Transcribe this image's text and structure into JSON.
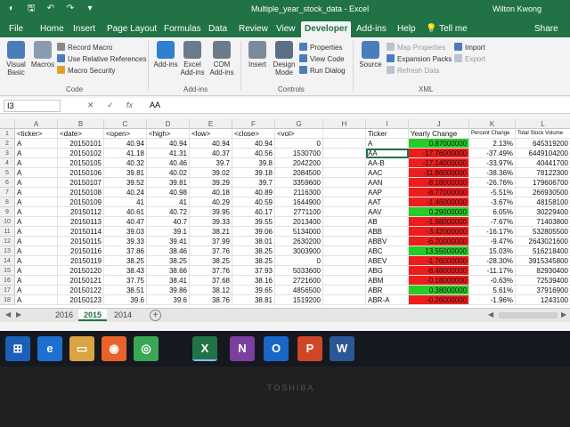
{
  "window": {
    "title": "Multiple_year_stock_data - Excel",
    "user": "Wilton Kwong"
  },
  "ribbon_tabs": [
    "File",
    "Home",
    "Insert",
    "Page Layout",
    "Formulas",
    "Data",
    "Review",
    "View",
    "Developer",
    "Add-ins",
    "Help"
  ],
  "active_tab": "Developer",
  "tell_me": "Tell me",
  "share": "Share",
  "ribbon": {
    "code": {
      "visual_basic": "Visual Basic",
      "macros": "Macros",
      "record_macro": "Record Macro",
      "relative_refs": "Use Relative References",
      "macro_security": "Macro Security",
      "label": "Code"
    },
    "addins": {
      "addins": "Add-ins",
      "excel_addins": "Excel Add-ins",
      "com_addins": "COM Add-ins",
      "label": "Add-ins"
    },
    "controls": {
      "insert": "Insert",
      "design_mode": "Design Mode",
      "properties": "Properties",
      "view_code": "View Code",
      "run_dialog": "Run Dialog",
      "label": "Controls"
    },
    "xml": {
      "source": "Source",
      "map_properties": "Map Properties",
      "expansion_packs": "Expansion Packs",
      "refresh_data": "Refresh Data",
      "import": "Import",
      "export": "Export",
      "label": "XML"
    }
  },
  "formula_bar": {
    "name_box": "I3",
    "value": "AA"
  },
  "columns": [
    "A",
    "B",
    "C",
    "D",
    "E",
    "F",
    "G",
    "H",
    "I",
    "J",
    "K",
    "L"
  ],
  "rows": [
    [
      "<ticker>",
      "<date>",
      "<open>",
      "<high>",
      "<low>",
      "<close>",
      "<vol>",
      "",
      "Ticker",
      "Yearly Change",
      "Percent Change",
      "Total Stock Volume"
    ],
    [
      "A",
      "20150101",
      "40.94",
      "40.94",
      "40.94",
      "40.94",
      "0",
      "",
      "A",
      "0.87000000",
      "2.13%",
      "645319200"
    ],
    [
      "A",
      "20150102",
      "41.18",
      "41.31",
      "40.37",
      "40.56",
      "1530700",
      "",
      "AA",
      "-17.76000000",
      "-37.49%",
      "6449104200"
    ],
    [
      "A",
      "20150105",
      "40.32",
      "40.46",
      "39.7",
      "39.8",
      "2042200",
      "",
      "AA-B",
      "-17.14000000",
      "-33.97%",
      "40441700"
    ],
    [
      "A",
      "20150106",
      "39.81",
      "40.02",
      "39.02",
      "39.18",
      "2084500",
      "",
      "AAC",
      "-11.86000000",
      "-38.36%",
      "78122300"
    ],
    [
      "A",
      "20150107",
      "39.52",
      "39.81",
      "39.29",
      "39.7",
      "3359600",
      "",
      "AAN",
      "-8.18000000",
      "-26.76%",
      "179606700"
    ],
    [
      "A",
      "20150108",
      "40.24",
      "40.98",
      "40.18",
      "40.89",
      "2116300",
      "",
      "AAP",
      "-8.77000000",
      "-5.51%",
      "266930500"
    ],
    [
      "A",
      "20150109",
      "41",
      "41",
      "40.29",
      "40.59",
      "1644900",
      "",
      "AAT",
      "-1.46000000",
      "-3.67%",
      "48158100"
    ],
    [
      "A",
      "20150112",
      "40.61",
      "40.72",
      "39.95",
      "40.17",
      "2771100",
      "",
      "AAV",
      "0.29000000",
      "6.05%",
      "30229400"
    ],
    [
      "A",
      "20150113",
      "40.47",
      "40.7",
      "39.33",
      "39.55",
      "2013400",
      "",
      "AB",
      "-1.98000000",
      "-7.67%",
      "71403800"
    ],
    [
      "A",
      "20150114",
      "39.03",
      "39.1",
      "38.21",
      "39.06",
      "5134000",
      "",
      "ABB",
      "-3.42000000",
      "-16.17%",
      "532805500"
    ],
    [
      "A",
      "20150115",
      "39.33",
      "39.41",
      "37.99",
      "38.01",
      "2630200",
      "",
      "ABBV",
      "-6.20000000",
      "-9.47%",
      "2643021600"
    ],
    [
      "A",
      "20150116",
      "37.86",
      "38.46",
      "37.76",
      "38.25",
      "3003900",
      "",
      "ABC",
      "13.55000000",
      "15.03%",
      "516218400"
    ],
    [
      "A",
      "20150119",
      "38.25",
      "38.25",
      "38.25",
      "38.25",
      "0",
      "",
      "ABEV",
      "-1.76000000",
      "-28.30%",
      "3915345800"
    ],
    [
      "A",
      "20150120",
      "38.43",
      "38.66",
      "37.76",
      "37.93",
      "5033600",
      "",
      "ABG",
      "-8.48000000",
      "-11.17%",
      "82930400"
    ],
    [
      "A",
      "20150121",
      "37.75",
      "38.41",
      "37.68",
      "38.16",
      "2721600",
      "",
      "ABM",
      "-0.18000000",
      "-0.63%",
      "72539400"
    ],
    [
      "A",
      "20150122",
      "38.51",
      "39.86",
      "38.12",
      "39.65",
      "4856500",
      "",
      "ABR",
      "0.38000000",
      "5.61%",
      "37916900"
    ],
    [
      "A",
      "20150123",
      "39.6",
      "39.6",
      "38.76",
      "38.81",
      "1519200",
      "",
      "ABR-A",
      "-0.26000000",
      "-1.96%",
      "1243100"
    ]
  ],
  "sheets": [
    "2016",
    "2015",
    "2014"
  ],
  "active_sheet": "2015",
  "taskbar": [
    "windows-start",
    "edge",
    "file-explorer",
    "firefox",
    "chrome",
    "excel",
    "onenote",
    "outlook",
    "powerpoint",
    "word"
  ],
  "bezel_brand": "TOSHIBA",
  "colors": {
    "excel_green": "#217346",
    "positive_fill": "#27cc27",
    "negative_fill": "#ee1c1c"
  }
}
